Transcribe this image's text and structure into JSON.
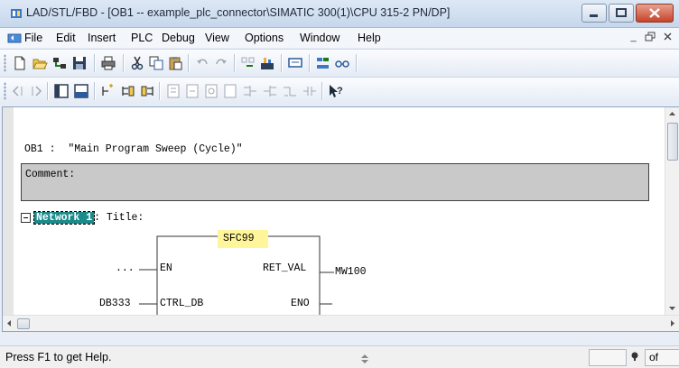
{
  "window": {
    "title": "LAD/STL/FBD  - [OB1 -- example_plc_connector\\SIMATIC 300(1)\\CPU 315-2 PN/DP]"
  },
  "menu": {
    "items": [
      "File",
      "Edit",
      "Insert",
      "PLC",
      "Debug",
      "View",
      "Options",
      "Window",
      "Help"
    ]
  },
  "editor": {
    "ob_label": "OB1 :",
    "ob_title": "\"Main Program Sweep (Cycle)\"",
    "comment_label": "Comment:",
    "network_label": "Network 1",
    "network_title": ": Title:"
  },
  "block": {
    "name": "SFC99",
    "in_pins": [
      "EN",
      "CTRL_DB"
    ],
    "out_pins": [
      "RET_VAL",
      "ENO"
    ],
    "inputs": {
      "en": "...",
      "ctrl_db": "DB333"
    },
    "outputs": {
      "ret_val": "MW100"
    }
  },
  "status": {
    "help_text": "Press F1 to get Help.",
    "field_right": "of"
  },
  "colors": {
    "highlight": "#fff59a",
    "network_bg": "#1d8a8a",
    "comment_bg": "#c9c9c9"
  },
  "icons": {
    "toolbar1": [
      "new-icon",
      "open-icon",
      "accessible-nodes-icon",
      "save-icon",
      "print-icon",
      "cut-icon",
      "copy-icon",
      "paste-icon",
      "undo-icon",
      "redo-icon",
      "overview-icon",
      "download-icon",
      "monitor-icon",
      "simulation-icon",
      "glasses-icon"
    ],
    "toolbar2": [
      "back-icon",
      "forward-icon",
      "program-elements-icon",
      "details-icon",
      "new-network-icon",
      "insert-left-icon",
      "insert-right-icon",
      "box-icon",
      "contact-icon",
      "branch-icon",
      "help-pointer-icon"
    ]
  }
}
